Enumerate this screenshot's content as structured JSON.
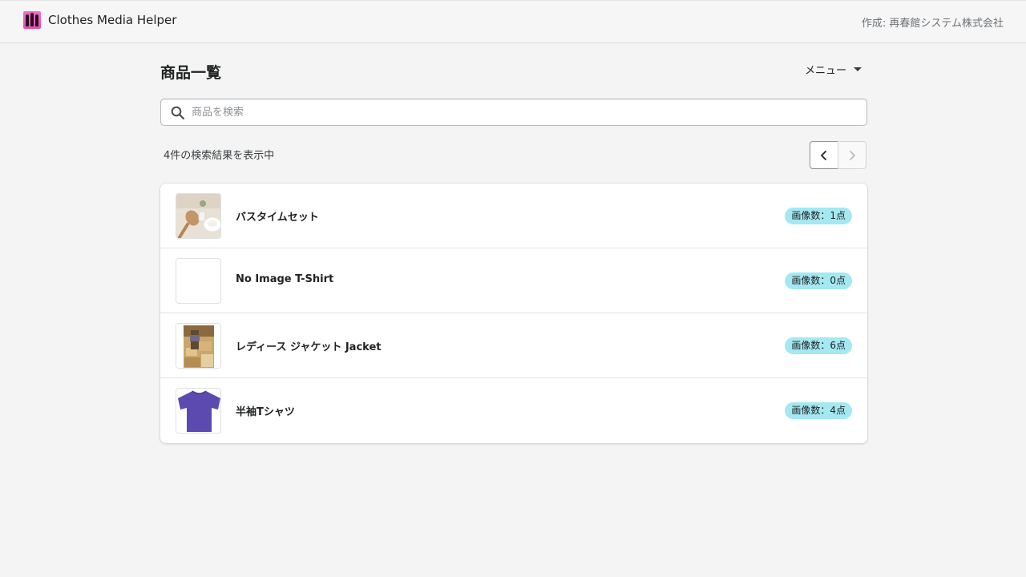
{
  "header": {
    "app_name": "Clothes Media Helper",
    "creator": "作成: 再春館システム株式会社"
  },
  "main": {
    "title": "商品一覧",
    "menu_label": "メニュー",
    "search": {
      "placeholder": "商品を検索",
      "value": ""
    },
    "result_count": "4件の検索結果を表示中",
    "products": [
      {
        "name": "バスタイムセット",
        "badge": "画像数：1点",
        "thumb": "bath-set"
      },
      {
        "name": "No Image T-Shirt",
        "badge": "画像数：0点",
        "thumb": "none"
      },
      {
        "name": "レディース ジャケット Jacket",
        "badge": "画像数：6点",
        "thumb": "jacket"
      },
      {
        "name": "半袖Tシャツ",
        "badge": "画像数：4点",
        "thumb": "tshirt"
      }
    ]
  },
  "colors": {
    "badge_bg": "#a4e8f2",
    "logo_pink": "#e04fb2",
    "tshirt": "#5c4ab0"
  },
  "icons": [
    "search-icon",
    "chevron-down-icon",
    "chevron-left-icon",
    "chevron-right-icon"
  ]
}
